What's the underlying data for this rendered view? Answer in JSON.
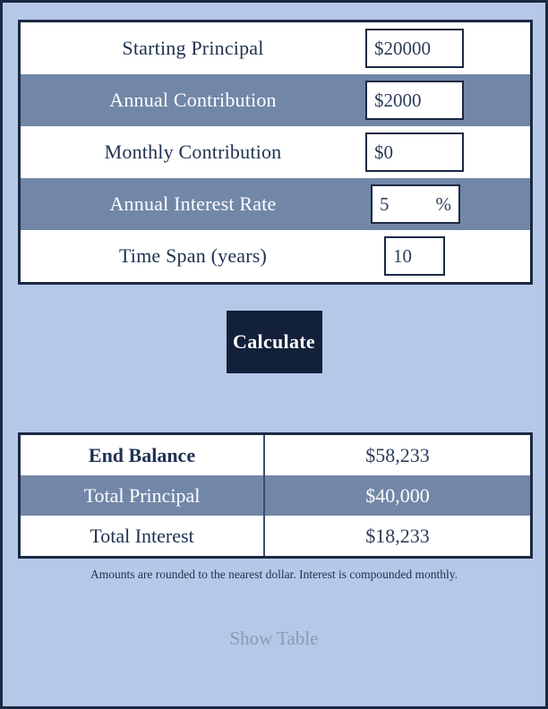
{
  "theme": {
    "page_background": "#b6c8e8",
    "border": "#1b2943",
    "stripe": "#7287a8",
    "text_dark": "#1e3152",
    "button_background": "#13203a",
    "link": "#8b9ab5"
  },
  "form": {
    "rows": [
      {
        "label": "Starting Principal",
        "value": "$20000",
        "suffix": ""
      },
      {
        "label": "Annual Contribution",
        "value": "$2000",
        "suffix": ""
      },
      {
        "label": "Monthly Contribution",
        "value": "$0",
        "suffix": ""
      },
      {
        "label": "Annual Interest Rate",
        "value": "5",
        "suffix": "%"
      },
      {
        "label": "Time Span (years)",
        "value": "10",
        "suffix": ""
      }
    ]
  },
  "actions": {
    "calculate_label": "Calculate",
    "show_table_label": "Show Table"
  },
  "results": {
    "rows": [
      {
        "label": "End Balance",
        "value": "$58,233"
      },
      {
        "label": "Total Principal",
        "value": "$40,000"
      },
      {
        "label": "Total Interest",
        "value": "$18,233"
      }
    ]
  },
  "footnote": "Amounts are rounded to the nearest dollar. Interest is compounded monthly."
}
